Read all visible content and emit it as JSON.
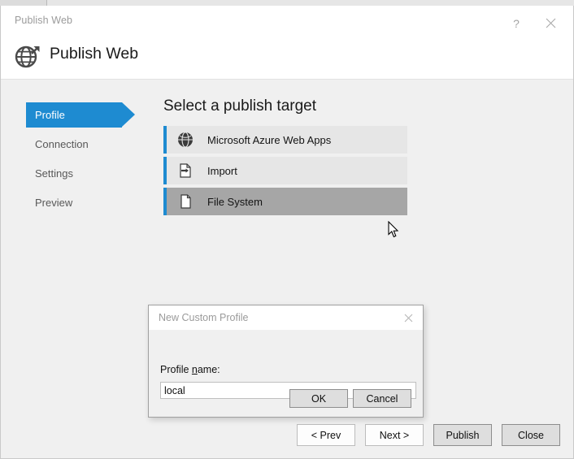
{
  "window": {
    "title": "Publish Web",
    "help_label": "?",
    "close_icon": "close-icon",
    "header_title": "Publish Web",
    "header_icon": "globe-publish-icon"
  },
  "sidebar": {
    "items": [
      {
        "label": "Profile",
        "active": true
      },
      {
        "label": "Connection",
        "active": false
      },
      {
        "label": "Settings",
        "active": false
      },
      {
        "label": "Preview",
        "active": false
      }
    ]
  },
  "main": {
    "heading": "Select a publish target",
    "targets": [
      {
        "label": "Microsoft Azure Web Apps",
        "icon": "azure-globe-icon",
        "selected": false
      },
      {
        "label": "Import",
        "icon": "import-file-icon",
        "selected": false
      },
      {
        "label": "File System",
        "icon": "file-page-icon",
        "selected": true
      }
    ]
  },
  "footer": {
    "buttons": [
      {
        "label": "< Prev",
        "style": "light"
      },
      {
        "label": "Next >",
        "style": "light"
      },
      {
        "label": "Publish",
        "style": "gray"
      },
      {
        "label": "Close",
        "style": "gray"
      }
    ]
  },
  "modal": {
    "title": "New Custom Profile",
    "close_icon": "close-icon",
    "field_label_prefix": "Profile ",
    "field_label_accel": "n",
    "field_label_suffix": "ame:",
    "input_value": "local",
    "input_placeholder": "",
    "ok_label": "OK",
    "cancel_label": "Cancel"
  },
  "colors": {
    "accent_blue": "#1e8bd1",
    "body_bg": "#f0f0f0",
    "target_bg": "#e6e6e6",
    "target_selected_bg": "#a6a6a6",
    "button_gray": "#dedede"
  }
}
